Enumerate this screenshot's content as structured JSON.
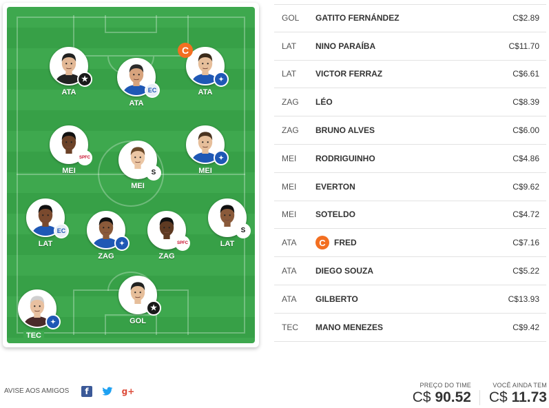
{
  "pitch": {
    "players": [
      {
        "id": "ata-1",
        "pos": "ATA",
        "club": "bot",
        "club_glyph": "★",
        "captain": false,
        "skin": "#e2b896",
        "hair": "#222222",
        "shirt": "#222222"
      },
      {
        "id": "ata-2",
        "pos": "ATA",
        "club": "bah",
        "club_glyph": "EC",
        "captain": false,
        "skin": "#d7a37d",
        "hair": "#2b2b2b",
        "shirt": "#1f58b5"
      },
      {
        "id": "ata-3",
        "pos": "ATA",
        "club": "cru",
        "club_glyph": "✦",
        "captain": true,
        "skin": "#e6be9a",
        "hair": "#3a2a1a",
        "shirt": "#1f58b5"
      },
      {
        "id": "mei-1",
        "pos": "MEI",
        "club": "sao",
        "club_glyph": "SPFC",
        "captain": false,
        "skin": "#6b4228",
        "hair": "#111111",
        "shirt": "#ffffff"
      },
      {
        "id": "mei-2",
        "pos": "MEI",
        "club": "san",
        "club_glyph": "S",
        "captain": false,
        "skin": "#ebc6a4",
        "hair": "#6b4a2a",
        "shirt": "#ffffff"
      },
      {
        "id": "mei-3",
        "pos": "MEI",
        "club": "cru",
        "club_glyph": "✦",
        "captain": false,
        "skin": "#e6be9a",
        "hair": "#4a3320",
        "shirt": "#1f58b5"
      },
      {
        "id": "lat-1",
        "pos": "LAT",
        "club": "bah",
        "club_glyph": "EC",
        "captain": false,
        "skin": "#7a4a2e",
        "hair": "#111111",
        "shirt": "#1f58b5"
      },
      {
        "id": "zag-1",
        "pos": "ZAG",
        "club": "cru",
        "club_glyph": "✦",
        "captain": false,
        "skin": "#8a5a3a",
        "hair": "#111111",
        "shirt": "#1f58b5"
      },
      {
        "id": "zag-2",
        "pos": "ZAG",
        "club": "sao",
        "club_glyph": "SPFC",
        "captain": false,
        "skin": "#5e3a22",
        "hair": "#111111",
        "shirt": "#ffffff"
      },
      {
        "id": "lat-2",
        "pos": "LAT",
        "club": "san",
        "club_glyph": "S",
        "captain": false,
        "skin": "#8a5a3a",
        "hair": "#111111",
        "shirt": "#ffffff"
      },
      {
        "id": "gol",
        "pos": "GOL",
        "club": "bot",
        "club_glyph": "★",
        "captain": false,
        "skin": "#e6be9a",
        "hair": "#222222",
        "shirt": "#ffffff"
      },
      {
        "id": "tec",
        "pos": "TEC",
        "club": "cru",
        "club_glyph": "✦",
        "captain": false,
        "skin": "#e8c0a0",
        "hair": "#cfcfcf",
        "shirt": "#4a2a2a"
      }
    ],
    "captain_mark": "C"
  },
  "lineup": [
    {
      "pos": "GOL",
      "name": "GATITO FERNÁNDEZ",
      "price": "C$2.89",
      "captain": false
    },
    {
      "pos": "LAT",
      "name": "NINO PARAÍBA",
      "price": "C$11.70",
      "captain": false
    },
    {
      "pos": "LAT",
      "name": "VICTOR FERRAZ",
      "price": "C$6.61",
      "captain": false
    },
    {
      "pos": "ZAG",
      "name": "LÉO",
      "price": "C$8.39",
      "captain": false
    },
    {
      "pos": "ZAG",
      "name": "BRUNO ALVES",
      "price": "C$6.00",
      "captain": false
    },
    {
      "pos": "MEI",
      "name": "RODRIGUINHO",
      "price": "C$4.86",
      "captain": false
    },
    {
      "pos": "MEI",
      "name": "EVERTON",
      "price": "C$9.62",
      "captain": false
    },
    {
      "pos": "MEI",
      "name": "SOTELDO",
      "price": "C$4.72",
      "captain": false
    },
    {
      "pos": "ATA",
      "name": "FRED",
      "price": "C$7.16",
      "captain": true
    },
    {
      "pos": "ATA",
      "name": "DIEGO SOUZA",
      "price": "C$5.22",
      "captain": false
    },
    {
      "pos": "ATA",
      "name": "GILBERTO",
      "price": "C$13.93",
      "captain": false
    },
    {
      "pos": "TEC",
      "name": "MANO MENEZES",
      "price": "C$9.42",
      "captain": false
    }
  ],
  "footer": {
    "share_label": "AVISE AOS AMIGOS",
    "facebook_glyph": "f",
    "twitter_glyph": "🐦",
    "googleplus_glyph": "g+",
    "team_price_label": "PREÇO DO TIME",
    "team_price_currency": "C$",
    "team_price_value": "90.52",
    "balance_label": "VOCÊ AINDA TEM",
    "balance_currency": "C$",
    "balance_value": "11.73"
  },
  "colors": {
    "pitch_green": "#3ea84e",
    "captain_orange": "#f36f21"
  }
}
